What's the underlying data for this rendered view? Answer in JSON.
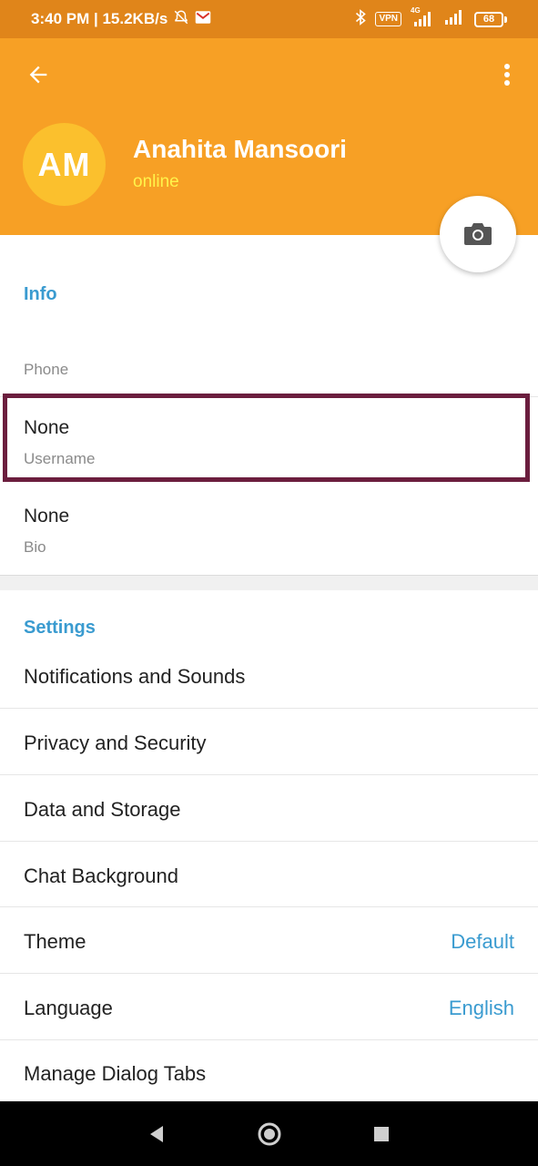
{
  "status_bar": {
    "time_speed": "3:40 PM | 15.2KB/s",
    "vpn": "VPN",
    "network": "4G",
    "battery": "68"
  },
  "header": {
    "avatar_initials": "AM",
    "name": "Anahita Mansoori",
    "status": "online"
  },
  "info": {
    "title": "Info",
    "phone_caption": "Phone",
    "username_value": "None",
    "username_caption": "Username",
    "bio_value": "None",
    "bio_caption": "Bio"
  },
  "settings": {
    "title": "Settings",
    "items": [
      {
        "label": "Notifications and Sounds",
        "value": ""
      },
      {
        "label": "Privacy and Security",
        "value": ""
      },
      {
        "label": "Data and Storage",
        "value": ""
      },
      {
        "label": "Chat Background",
        "value": ""
      },
      {
        "label": "Theme",
        "value": "Default"
      },
      {
        "label": "Language",
        "value": "English"
      },
      {
        "label": "Manage Dialog Tabs",
        "value": ""
      }
    ]
  },
  "colors": {
    "header": "#f7a025",
    "status_bar": "#e0851a",
    "accent": "#3a9bd0",
    "highlight": "#6b1e3e"
  }
}
